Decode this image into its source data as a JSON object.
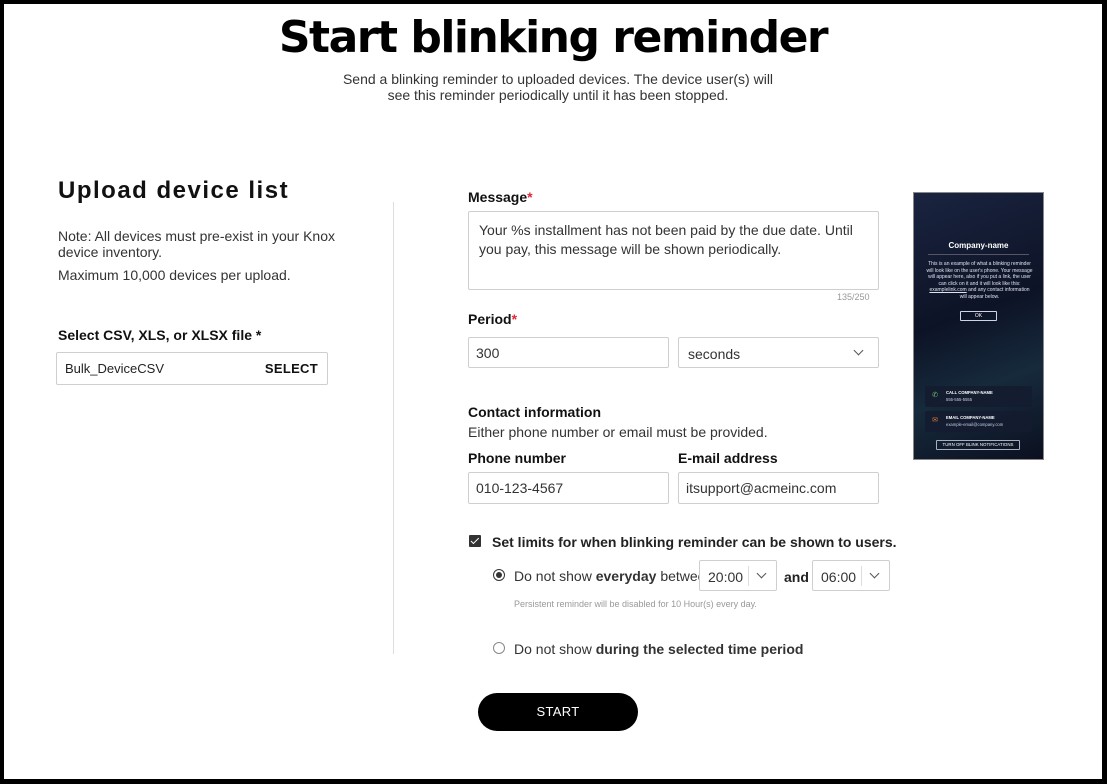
{
  "header": {
    "title": "Start blinking reminder",
    "subtitle": "Send a blinking reminder to uploaded devices. The device user(s) will see this reminder periodically until it has been stopped."
  },
  "upload": {
    "heading": "Upload device list",
    "note": "Note: All devices must pre-exist in your Knox device inventory.",
    "max_note": "Maximum 10,000 devices per upload.",
    "file_label": "Select CSV, XLS, or XLSX file *",
    "file_value": "Bulk_DeviceCSV",
    "select_label": "SELECT"
  },
  "message": {
    "label": "Message",
    "required_mark": "*",
    "value": "Your %s installment has not been paid by the due date. Until you pay, this message will be shown periodically.",
    "counter": "135/250"
  },
  "period": {
    "label": "Period",
    "required_mark": "*",
    "value": "300",
    "unit": "seconds"
  },
  "contact": {
    "label": "Contact information",
    "note": "Either phone number or email must be provided.",
    "phone_label": "Phone number",
    "phone_value": "010-123-4567",
    "email_label": "E-mail address",
    "email_value": "itsupport@acmeinc.com"
  },
  "limits": {
    "checked": true,
    "label": "Set limits for when blinking reminder can be shown  to users.",
    "option1_prefix": "Do not show ",
    "option1_bold": "everyday",
    "option1_suffix": " between",
    "from_time": "20:00",
    "and_label": "and",
    "to_time": "06:00",
    "helper": "Persistent reminder will be disabled for 10 Hour(s) every day.",
    "option2_prefix": "Do not show ",
    "option2_bold": "during the selected time period"
  },
  "start_label": "START",
  "preview": {
    "company": "Company-name",
    "body": "This is an example of what a blinking reminder will look like on the user's phone. Your message will appear here, also if you put a link, the user can click on it and it will look like this: ",
    "link": "examplelink.com",
    "body_end": " and any contact information will appear below.",
    "ok": "OK",
    "call_title": "CALL COMPANY-NAME",
    "call_value": "555-555-5555",
    "email_title": "EMAIL COMPANY-NAME",
    "email_value": "example-email@company.com",
    "turn_off": "TURN OFF BLINK NOTIFICATIONS",
    "phone_icon": "phone-icon",
    "mail_icon": "mail-icon"
  },
  "colors": {
    "required": "#e0283a",
    "primary_button": "#000000"
  }
}
